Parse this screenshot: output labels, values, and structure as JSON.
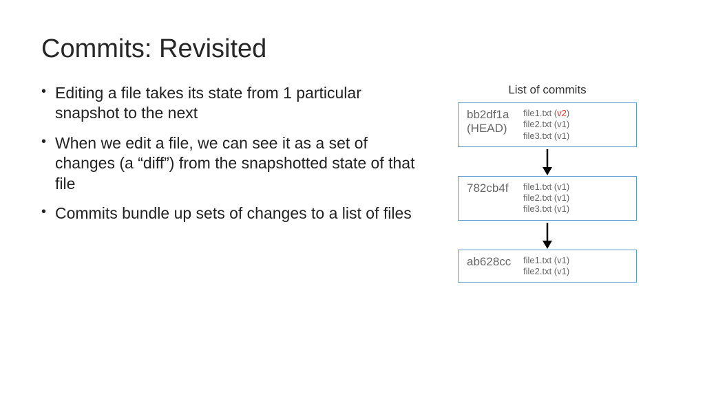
{
  "title": "Commits: Revisited",
  "bullets": [
    "Editing a file takes its state from 1 particular snapshot to the next",
    "When we edit a file, we can see it as a set of changes (a “diff”) from the snapshotted state of that file",
    "Commits bundle up sets of changes to a list of files"
  ],
  "diagram": {
    "title": "List of commits",
    "commits": [
      {
        "hash": "bb2df1a",
        "head": "(HEAD)",
        "files": [
          {
            "name": "file1.txt",
            "ver": "v2",
            "highlight": true
          },
          {
            "name": "file2.txt",
            "ver": "v1",
            "highlight": false
          },
          {
            "name": "file3.txt",
            "ver": "v1",
            "highlight": false
          }
        ]
      },
      {
        "hash": "782cb4f",
        "head": "",
        "files": [
          {
            "name": "file1.txt",
            "ver": "v1",
            "highlight": false
          },
          {
            "name": "file2.txt",
            "ver": "v1",
            "highlight": false
          },
          {
            "name": "file3.txt",
            "ver": "v1",
            "highlight": false
          }
        ]
      },
      {
        "hash": "ab628cc",
        "head": "",
        "files": [
          {
            "name": "file1.txt",
            "ver": "v1",
            "highlight": false
          },
          {
            "name": "file2.txt",
            "ver": "v1",
            "highlight": false
          }
        ]
      }
    ]
  }
}
